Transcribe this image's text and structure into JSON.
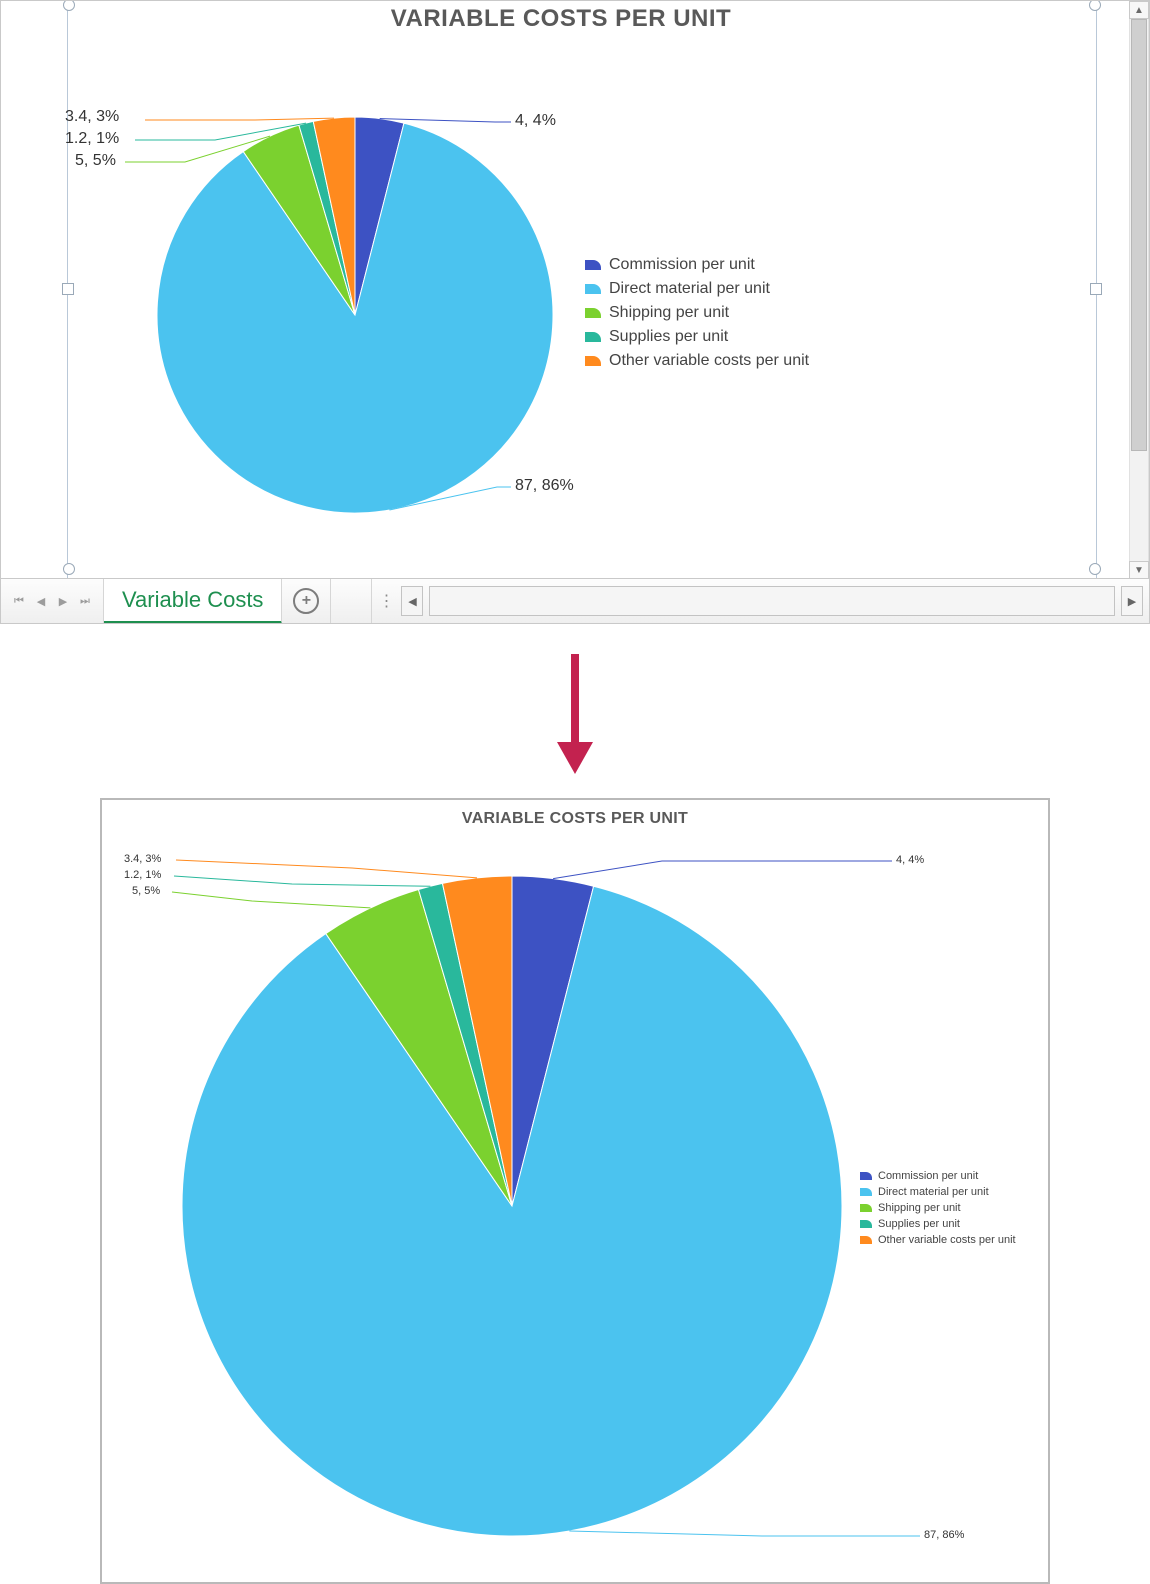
{
  "chart_data": {
    "type": "pie",
    "title": "VARIABLE COSTS PER UNIT",
    "series": [
      {
        "name": "Commission per unit",
        "value": 4,
        "percent": 4,
        "label": "4, 4%",
        "color": "#3d52c3"
      },
      {
        "name": "Direct material per unit",
        "value": 87,
        "percent": 86,
        "label": "87, 86%",
        "color": "#4bc3ef"
      },
      {
        "name": "Shipping per unit",
        "value": 5,
        "percent": 5,
        "label": "5, 5%",
        "color": "#7bd12f"
      },
      {
        "name": "Supplies per unit",
        "value": 1.2,
        "percent": 1,
        "label": "1.2, 1%",
        "color": "#29b89c"
      },
      {
        "name": "Other variable costs per unit",
        "value": 3.4,
        "percent": 3,
        "label": "3.4, 3%",
        "color": "#ff8a1e"
      }
    ]
  },
  "excel": {
    "sheet_tab": "Variable Costs"
  },
  "bottom_chart": {
    "title": "VARIABLE COSTS PER UNIT"
  }
}
